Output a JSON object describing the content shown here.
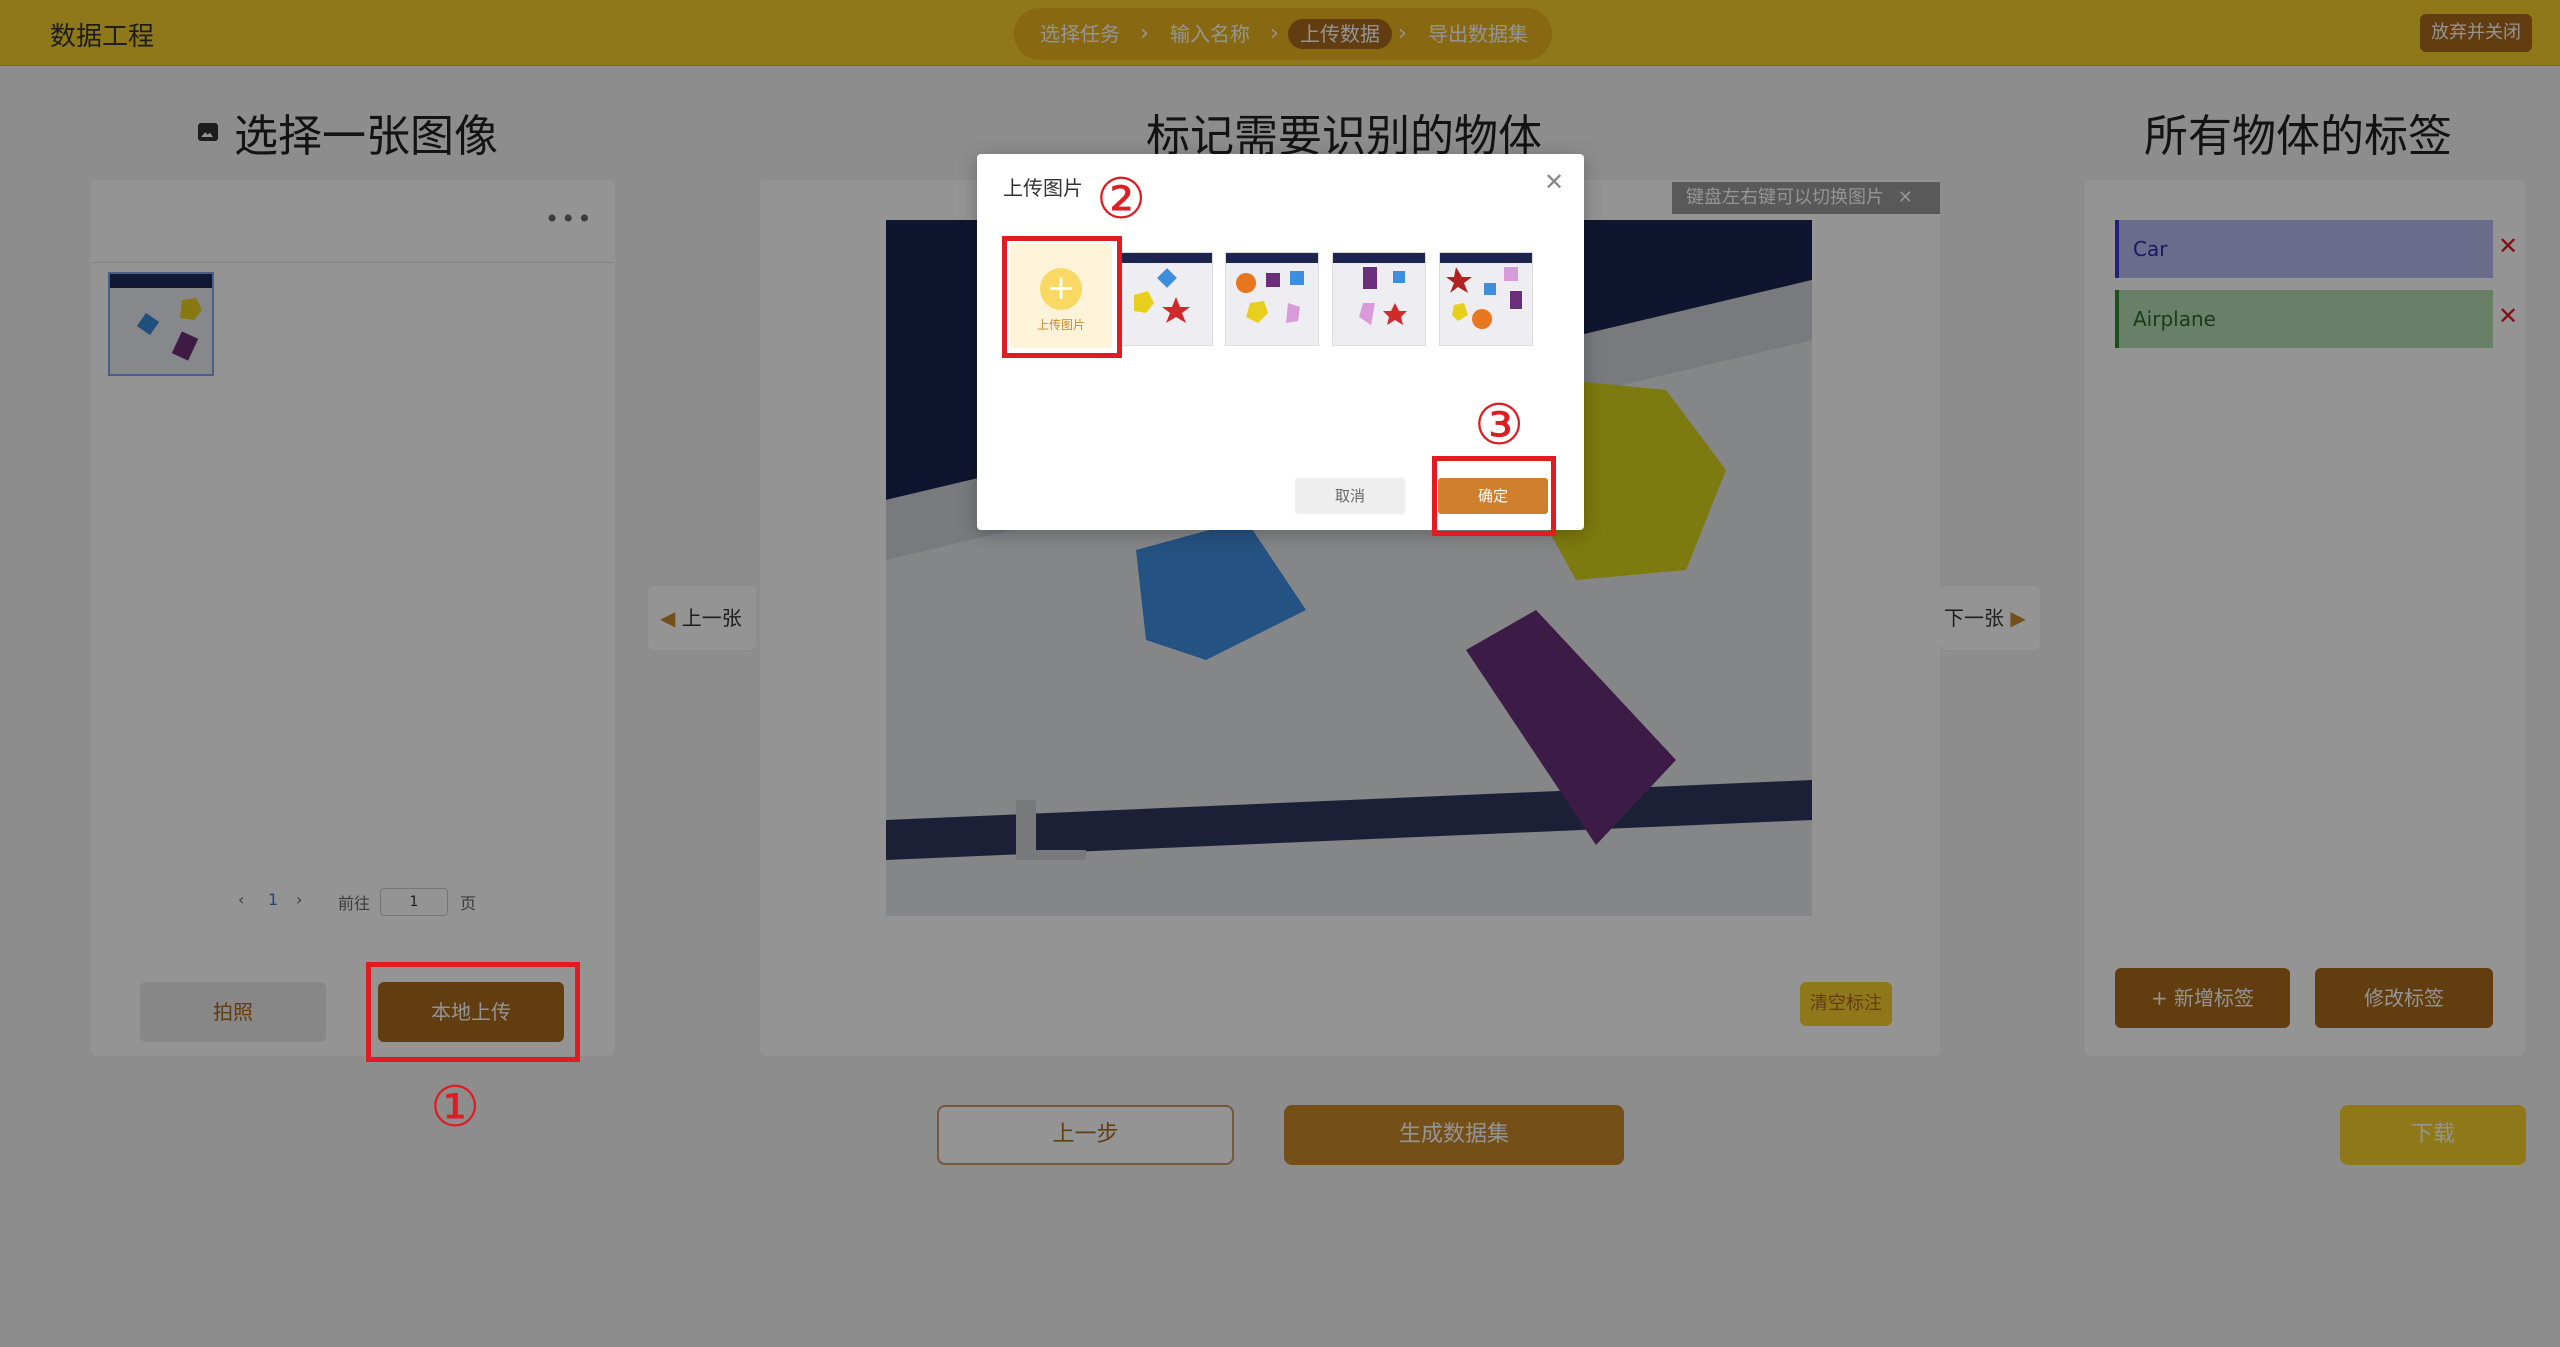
{
  "header": {
    "app_title": "数据工程",
    "steps": [
      "选择任务",
      "输入名称",
      "上传数据",
      "导出数据集"
    ],
    "active_step": 2,
    "close_label": "放弃并关闭"
  },
  "left": {
    "title": "选择一张图像",
    "more_icon": "more-horizontal-icon",
    "pagination": {
      "current_page": "1",
      "goto_prefix": "前往",
      "goto_value": "1",
      "goto_suffix": "页"
    },
    "photo_label": "拍照",
    "upload_label": "本地上传"
  },
  "center": {
    "title": "标记需要识别的物体",
    "keyboard_hint": "键盘左右键可以切换图片",
    "prev_label": "上一张",
    "next_label": "下一张",
    "clear_label": "清空标注"
  },
  "right": {
    "title": "所有物体的标签",
    "labels": [
      {
        "name": "Car",
        "bg": "#b8b8f0",
        "border": "#3a3ad6",
        "text_color": "#2a2aa8"
      },
      {
        "name": "Airplane",
        "bg": "#b4dcb4",
        "border": "#2e8b2e",
        "text_color": "#2a6a2a"
      }
    ],
    "add_label": "+ 新增标签",
    "edit_label": "修改标签"
  },
  "footer": {
    "prev_step": "上一步",
    "generate": "生成数据集",
    "download": "下载"
  },
  "dialog": {
    "title": "上传图片",
    "upload_tile_label": "上传图片",
    "cancel": "取消",
    "confirm": "确定"
  },
  "annotations": {
    "circle_1": "①",
    "circle_2": "②",
    "circle_3": "③"
  },
  "colors": {
    "brand_yellow": "#f4cf2c",
    "brand_brown": "#a9691c",
    "highlight_red": "#e11b22"
  }
}
